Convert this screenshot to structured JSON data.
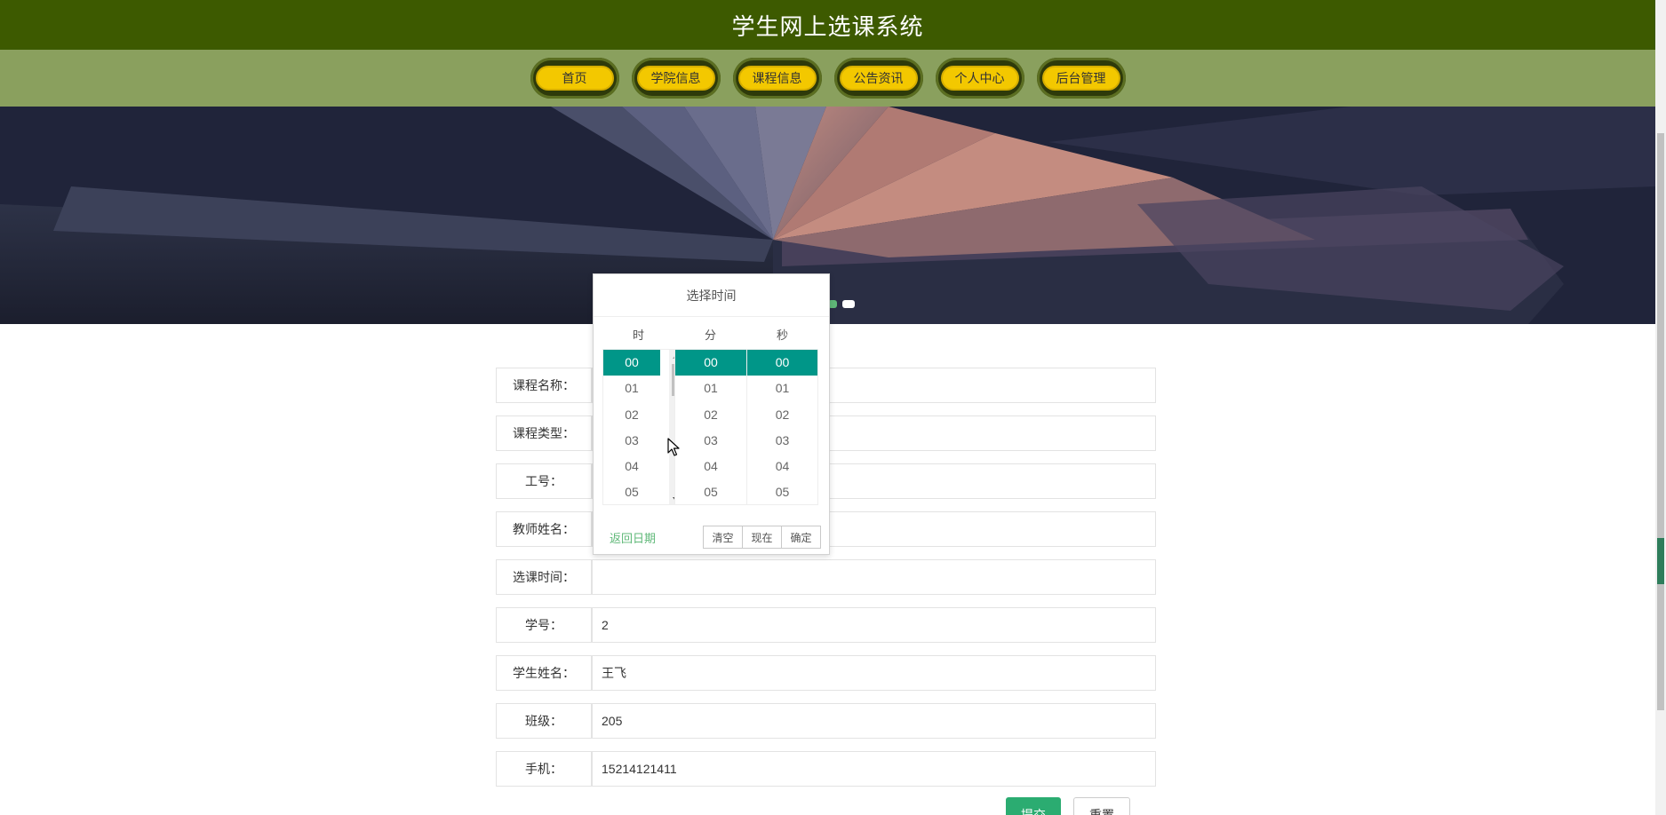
{
  "header": {
    "title": "学生网上选课系统"
  },
  "nav": {
    "items": [
      {
        "label": "首页"
      },
      {
        "label": "学院信息"
      },
      {
        "label": "课程信息"
      },
      {
        "label": "公告资讯"
      },
      {
        "label": "个人中心"
      },
      {
        "label": "后台管理"
      }
    ]
  },
  "form": {
    "fields": [
      {
        "label": "课程名称：",
        "value": ""
      },
      {
        "label": "课程类型：",
        "value": ""
      },
      {
        "label": "工号：",
        "value": ""
      },
      {
        "label": "教师姓名：",
        "value": ""
      },
      {
        "label": "选课时间：",
        "value": ""
      },
      {
        "label": "学号：",
        "value": "2"
      },
      {
        "label": "学生姓名：",
        "value": "王飞"
      },
      {
        "label": "班级：",
        "value": "205"
      },
      {
        "label": "手机：",
        "value": "15214121411"
      }
    ],
    "submit_label": "提交",
    "reset_label": "重置"
  },
  "time_picker": {
    "title": "选择时间",
    "columns": [
      {
        "label": "时",
        "items": [
          "00",
          "01",
          "02",
          "03",
          "04",
          "05"
        ],
        "selected": "00"
      },
      {
        "label": "分",
        "items": [
          "00",
          "01",
          "02",
          "03",
          "04",
          "05"
        ],
        "selected": "00"
      },
      {
        "label": "秒",
        "items": [
          "00",
          "01",
          "02",
          "03",
          "04",
          "05"
        ],
        "selected": "00"
      }
    ],
    "back_label": "返回日期",
    "clear_label": "清空",
    "now_label": "现在",
    "confirm_label": "确定"
  },
  "colors": {
    "header_bg": "#3d5a00",
    "nav_bg": "#8aa05e",
    "nav_pill": "#f3c800",
    "picker_selected": "#009688",
    "primary_button": "#2bac71"
  }
}
